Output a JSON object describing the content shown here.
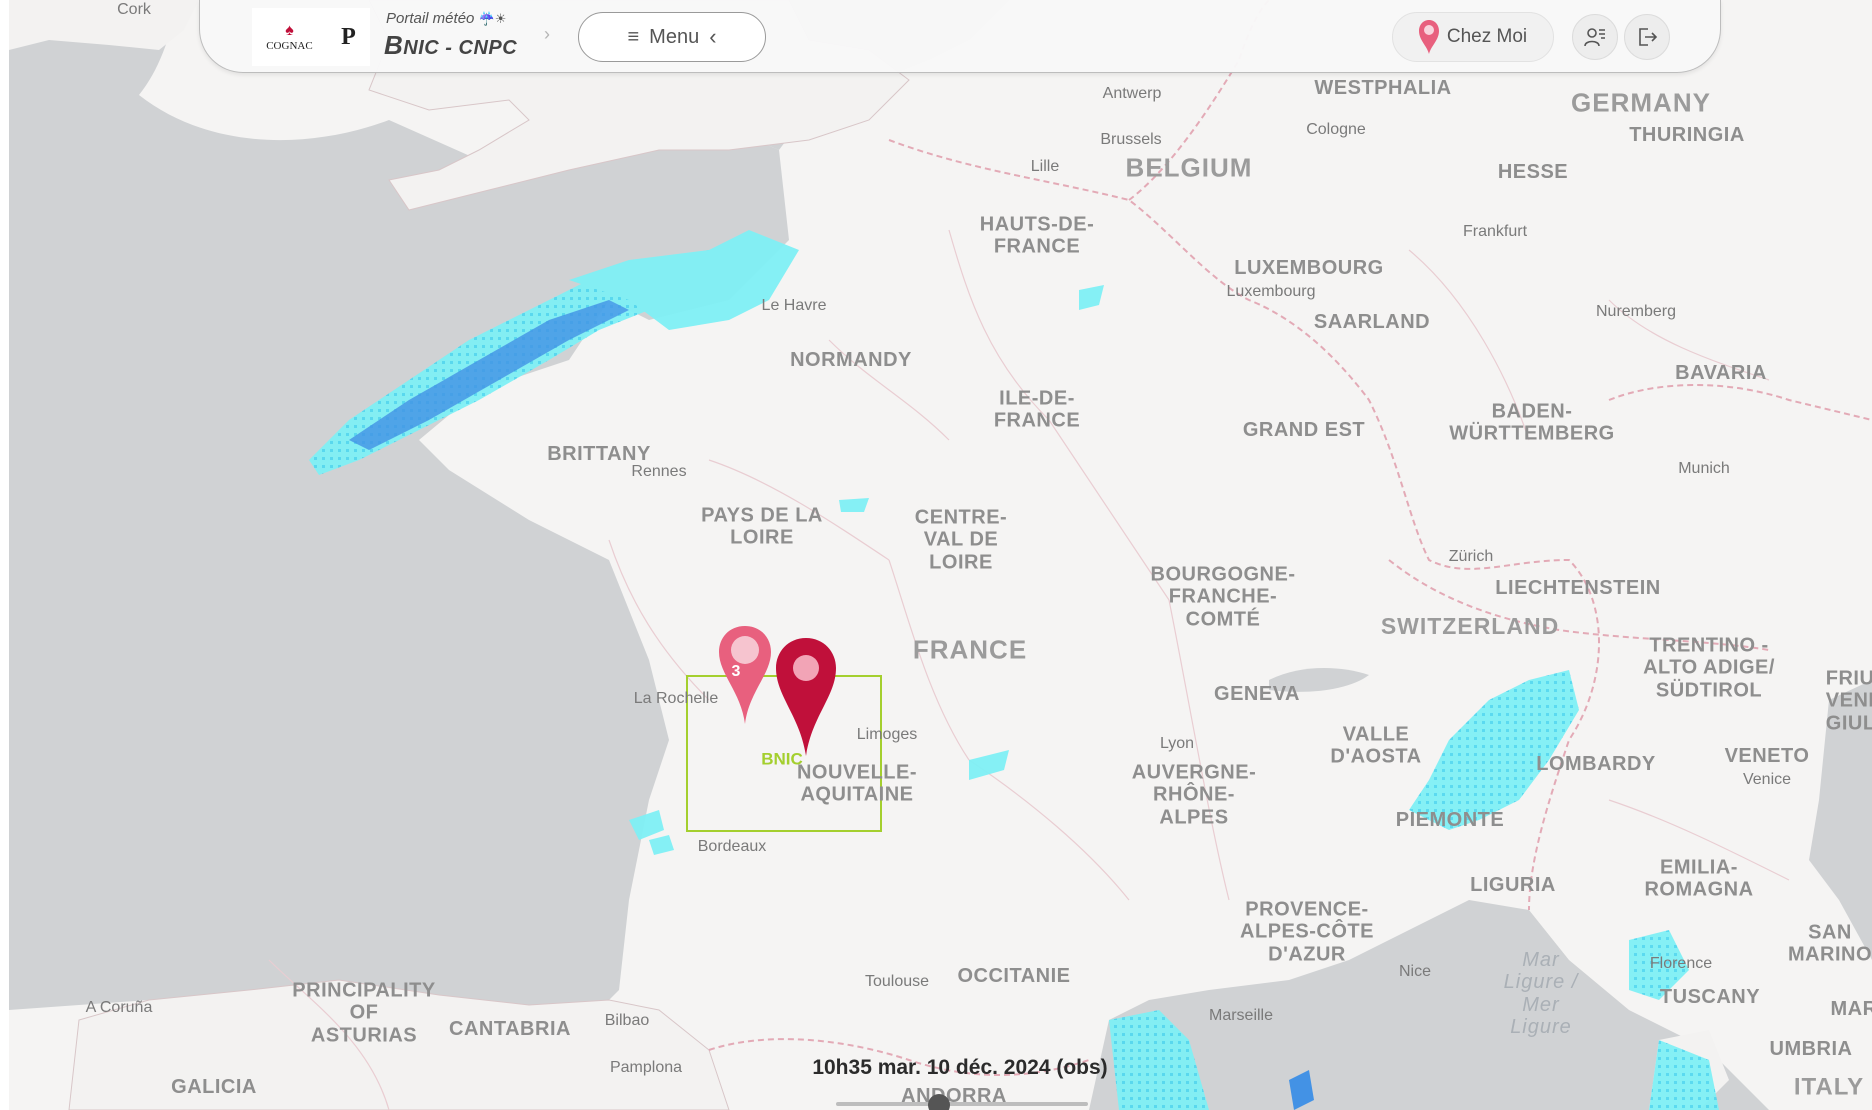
{
  "header": {
    "logo_text_left": "COGNAC",
    "logo_text_right": "P",
    "portal_label": "Portail météo",
    "brand_prefix": "B",
    "brand_rest": "NIC - CNPC",
    "menu_label": "Menu",
    "home_label": "Chez Moi"
  },
  "map": {
    "countries": [
      "GERMANY",
      "BELGIUM",
      "FRANCE",
      "SWITZERLAND",
      "LIECHTENSTEIN",
      "LUXEMBOURG",
      "ITALY"
    ],
    "regions": [
      "WESTPHALIA",
      "THURINGIA",
      "HESSE",
      "HAUTS-DE-\nFRANCE",
      "SAARLAND",
      "NORMANDY",
      "ILE-DE-\nFRANCE",
      "GRAND EST",
      "BADEN-\nWÜRTTEMBERG",
      "BAVARIA",
      "BRITTANY",
      "PAYS DE LA\nLOIRE",
      "CENTRE-\nVAL DE\nLOIRE",
      "BOURGOGNE-\nFRANCHE-\nCOMTÉ",
      "TRENTINO -\nALTO ADIGE/\nSÜDTIROL",
      "FRIU\nVENE\nGIUL",
      "NOUVELLE-\nAQUITAINE",
      "AUVERGNE-\nRHÔNE-\nALPES",
      "VALLE\nD'AOSTA",
      "LOMBARDY",
      "VENETO",
      "PIEMONTE",
      "LIGURIA",
      "EMILIA-\nROMAGNA",
      "SAN\nMARINO",
      "TUSCANY",
      "MAR",
      "UMBRIA",
      "PROVENCE-\nALPES-CÔTE\nD'AZUR",
      "OCCITANIE",
      "PRINCIPALITY\nOF\nASTURIAS",
      "CANTABRIA",
      "GALICIA",
      "ANDORRA"
    ],
    "cities": [
      "Antwerp",
      "Brussels",
      "Cologne",
      "Lille",
      "Frankfurt",
      "Luxembourg",
      "Nuremberg",
      "Le Havre",
      "Rennes",
      "Munich",
      "Zürich",
      "La Rochelle",
      "Limoges",
      "GENEVA",
      "Lyon",
      "Venice",
      "Bordeaux",
      "Toulouse",
      "Nice",
      "Marseille",
      "Florence",
      "A Coruña",
      "Bilbao",
      "Pamplona",
      "Cork"
    ],
    "sea": "Mar\nLigure /\nMer\nLigure",
    "bnic_label": "BNIC",
    "cluster_count": "3"
  },
  "timeline": {
    "timestamp": "10h35 mar. 10 déc. 2024 (obs)",
    "position": 0.41
  },
  "colors": {
    "pin_dark": "#c0103a",
    "pin_light": "#e8607e",
    "bnic_box": "#a4cf2e",
    "radar_light": "#7ff0f5",
    "radar_dark": "#3b8fe6"
  }
}
